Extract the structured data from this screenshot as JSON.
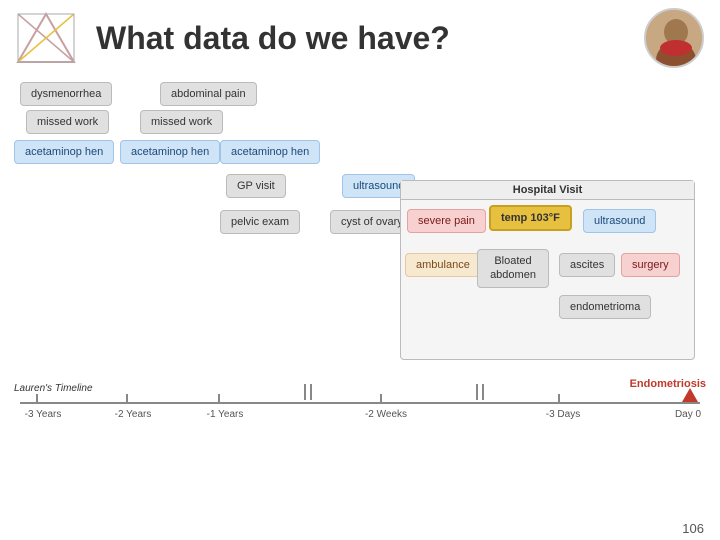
{
  "header": {
    "title": "What data do we have?",
    "logo_alt": "cross-icon"
  },
  "chips": {
    "dysmenorrhea": "dysmenorrhea",
    "abdominal_pain": "abdominal pain",
    "missed_work_1": "missed work",
    "missed_work_2": "missed work",
    "acetaminop_hen_1": "acetaminop hen",
    "acetaminop_hen_2": "acetaminop hen",
    "acetaminop_hen_3": "acetaminop hen",
    "gp_visit": "GP visit",
    "ultrasound_1": "ultrasound",
    "pelvic_exam": "pelvic exam",
    "cyst_of_ovary": "cyst of ovary",
    "hospital_visit": "Hospital Visit",
    "severe_pain": "severe pain",
    "temp_103": "temp 103°F",
    "ultrasound_2": "ultrasound",
    "ambulance": "ambulance",
    "bloated_abdomen": "Bloated abdomen",
    "ascites": "ascites",
    "surgery": "surgery",
    "endometrioma": "endometrioma",
    "endometriosis": "Endometriosis"
  },
  "timeline": {
    "labels": [
      "-3 Years",
      "-2 Years",
      "-1 Years",
      "-2 Weeks",
      "-3 Days",
      "Day 0"
    ],
    "lauren_label": "Lauren's Timeline"
  },
  "page_number": "106"
}
